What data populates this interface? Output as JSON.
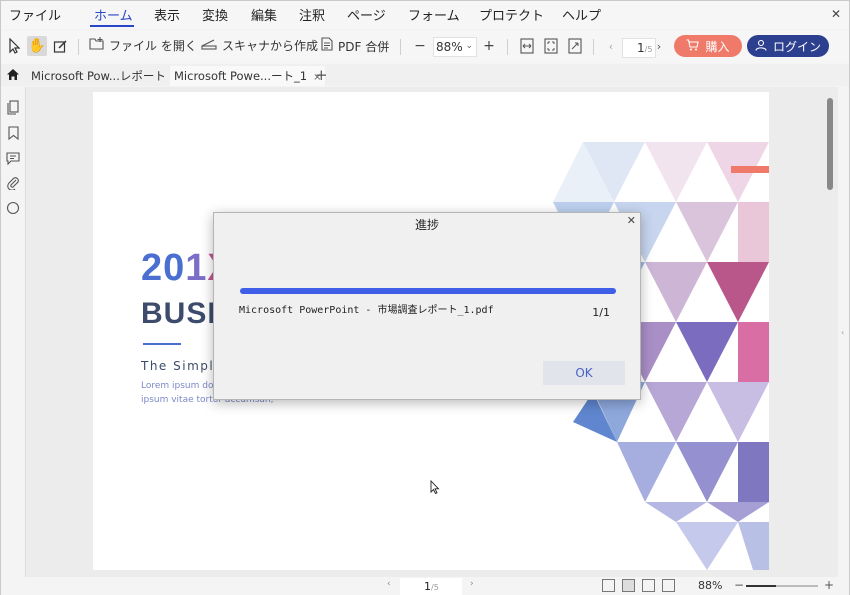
{
  "menu": {
    "items": [
      "ファイル",
      "ホーム",
      "表示",
      "変換",
      "編集",
      "注釈",
      "ページ",
      "フォーム",
      "プロテクト",
      "ヘルプ"
    ],
    "active_index": 1
  },
  "toolbar": {
    "open_file_label": "ファイル を開く",
    "scanner_label": "スキャナから作成",
    "merge_label": "PDF 合併",
    "zoom_value": "88%",
    "page_current": "1",
    "page_total": "/5",
    "buy_label": "購入",
    "login_label": "ログイン"
  },
  "tabs": [
    {
      "label": "Microsoft Pow...レポート"
    },
    {
      "label": "Microsoft Powe...ート_1"
    }
  ],
  "document": {
    "title_a": "20",
    "title_b": "1",
    "title_c": "X",
    "title_line2": "BUSI",
    "subtitle": "The Simple",
    "lorem_line1": "Lorem ipsum dolo",
    "lorem_line2": "ipsum vitae tortor accumsan,"
  },
  "dialog": {
    "title": "進捗",
    "progress_percent": 100,
    "file_name": "Microsoft PowerPoint - 市場調査レポート_1.pdf",
    "count": "1/1",
    "ok_label": "OK"
  },
  "statusbar": {
    "page_current": "1",
    "page_total": "/5",
    "zoom": "88%"
  },
  "colors": {
    "accent": "#2a47c9",
    "buy": "#f07a6a",
    "login": "#2d3f8f",
    "progress": "#3f5fe8"
  }
}
